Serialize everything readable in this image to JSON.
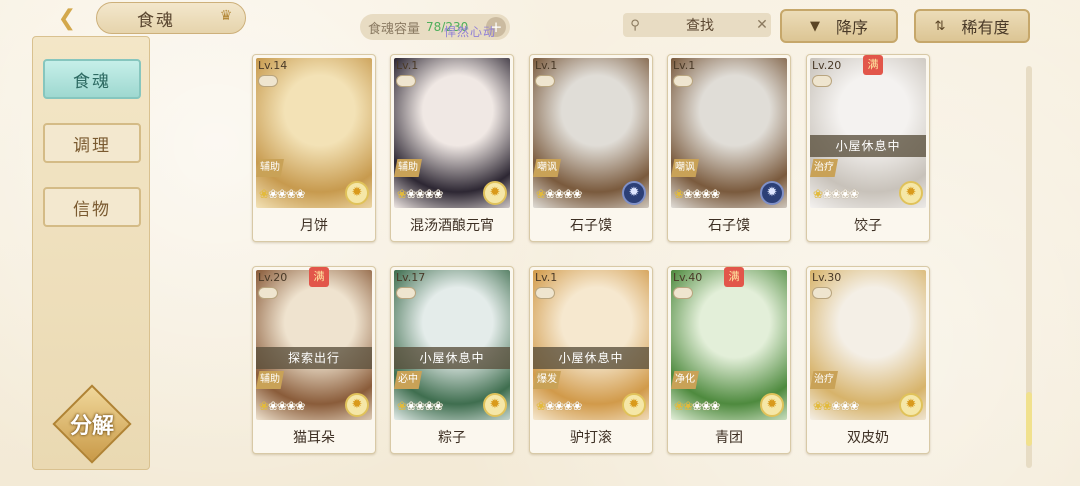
{
  "header": {
    "title": "食魂",
    "capacity_label": "食魂容量",
    "capacity_count": "78/230",
    "watermark": "悍然心动",
    "search_label": "查找",
    "sort_desc_label": "降序",
    "sort_rarity_label": "稀有度"
  },
  "sidebar": {
    "tabs": [
      {
        "label": "食魂",
        "active": true
      },
      {
        "label": "调理",
        "active": false
      },
      {
        "label": "信物",
        "active": false
      }
    ],
    "decompose_label": "分解"
  },
  "cards": [
    {
      "level": "Lv.14",
      "name": "月饼",
      "role": "辅助",
      "stars_filled": 1,
      "element": "light",
      "status": "",
      "full": false,
      "colors": [
        "#f3e2b6",
        "#c79a4e"
      ]
    },
    {
      "level": "Lv.1",
      "name": "混汤酒酿元宵",
      "role": "辅助",
      "stars_filled": 1,
      "element": "light",
      "status": "",
      "full": false,
      "colors": [
        "#f0e8e4",
        "#2d2733"
      ]
    },
    {
      "level": "Lv.1",
      "name": "石子馍",
      "role": "嘲讽",
      "stars_filled": 1,
      "element": "dark",
      "status": "",
      "full": false,
      "colors": [
        "#e0ddd7",
        "#7a5a3d"
      ]
    },
    {
      "level": "Lv.1",
      "name": "石子馍",
      "role": "嘲讽",
      "stars_filled": 1,
      "element": "dark",
      "status": "",
      "full": false,
      "colors": [
        "#e0ddd7",
        "#7a5a3d"
      ]
    },
    {
      "level": "Lv.20",
      "name": "饺子",
      "role": "治疗",
      "stars_filled": 1,
      "element": "light",
      "status": "小屋休息中",
      "full": true,
      "colors": [
        "#f4f2f0",
        "#c8c2ba"
      ]
    },
    {
      "level": "Lv.20",
      "name": "猫耳朵",
      "role": "辅助",
      "stars_filled": 1,
      "element": "light",
      "status": "探索出行",
      "full": true,
      "colors": [
        "#efe3cf",
        "#8a5c3a"
      ]
    },
    {
      "level": "Lv.17",
      "name": "粽子",
      "role": "必中",
      "stars_filled": 1,
      "element": "light",
      "status": "小屋休息中",
      "full": false,
      "colors": [
        "#e4ecea",
        "#3f6e4f"
      ]
    },
    {
      "level": "Lv.1",
      "name": "驴打滚",
      "role": "爆发",
      "stars_filled": 1,
      "element": "light",
      "status": "小屋休息中",
      "full": false,
      "colors": [
        "#f6e8cf",
        "#d19a4a"
      ]
    },
    {
      "level": "Lv.40",
      "name": "青团",
      "role": "净化",
      "stars_filled": 2,
      "element": "light",
      "status": "",
      "full": true,
      "colors": [
        "#e3efd9",
        "#4e8a3e"
      ]
    },
    {
      "level": "Lv.30",
      "name": "双皮奶",
      "role": "治疗",
      "stars_filled": 2,
      "element": "light",
      "status": "",
      "full": false,
      "colors": [
        "#f4efe6",
        "#d7b36a"
      ]
    }
  ],
  "scroll": {
    "position": 0.82
  },
  "icons": {
    "back": "back-arrow-icon",
    "crown": "crown-icon",
    "search": "search-icon",
    "clear": "close-icon",
    "sort_desc": "triangle-down-icon",
    "sort_rarity": "sort-arrows-icon"
  },
  "labels": {
    "full_badge": "满"
  }
}
